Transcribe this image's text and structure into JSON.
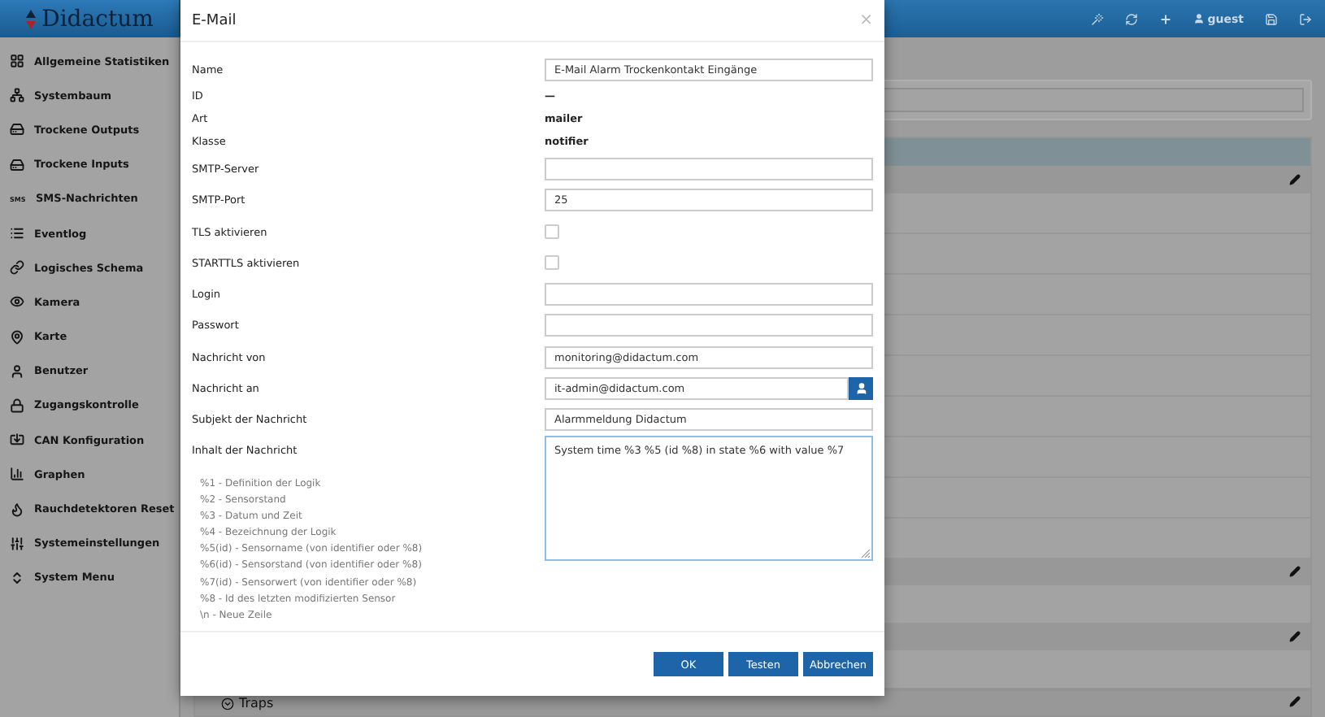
{
  "topbar": {
    "logo": "Didactum",
    "user": "guest"
  },
  "sidebar": {
    "items": [
      {
        "label": "Allgemeine Statistiken"
      },
      {
        "label": "Systembaum"
      },
      {
        "label": "Trockene Outputs"
      },
      {
        "label": "Trockene Inputs"
      },
      {
        "label": "SMS-Nachrichten",
        "badge": "SMS"
      },
      {
        "label": "Eventlog"
      },
      {
        "label": "Logisches Schema"
      },
      {
        "label": "Kamera"
      },
      {
        "label": "Karte"
      },
      {
        "label": "Benutzer"
      },
      {
        "label": "Zugangskontrolle"
      },
      {
        "label": "CAN Konfiguration"
      },
      {
        "label": "Graphen"
      },
      {
        "label": "Rauchdetektoren Reset"
      },
      {
        "label": "Systemeinstellungen"
      },
      {
        "label": "System Menu"
      }
    ]
  },
  "background": {
    "section_label": "Traps"
  },
  "dialog": {
    "title": "E-Mail",
    "close": "×",
    "fields": [
      {
        "kind": "text",
        "label": "Name",
        "value": "E-Mail Alarm Trockenkontakt Eingänge"
      },
      {
        "kind": "static",
        "label": "ID",
        "value": "—"
      },
      {
        "kind": "static",
        "label": "Art",
        "value": "mailer"
      },
      {
        "kind": "static",
        "label": "Klasse",
        "value": "notifier"
      },
      {
        "kind": "text",
        "label": "SMTP-Server"
      },
      {
        "kind": "text",
        "label": "SMTP-Port",
        "value": "25"
      },
      {
        "kind": "checkbox",
        "label": "TLS aktivieren",
        "checked": false
      },
      {
        "kind": "checkbox",
        "label": "STARTTLS aktivieren",
        "checked": false
      },
      {
        "kind": "text",
        "label": "Login"
      },
      {
        "kind": "text",
        "label": "Passwort"
      },
      {
        "kind": "text",
        "label": "Nachricht von",
        "value": "monitoring@didactum.com"
      },
      {
        "kind": "picker",
        "label": "Nachricht an",
        "value": "it-admin@didactum.com"
      },
      {
        "kind": "text",
        "label": "Subjekt der Nachricht",
        "value": "Alarmmeldung Didactum"
      },
      {
        "kind": "textarea",
        "label": "Inhalt der Nachricht",
        "value": "System time %3 %5 (id %8) in state %6 with value %7"
      }
    ],
    "hints": [
      "%1 - Definition der Logik",
      "%2 - Sensorstand",
      "%3 - Datum und Zeit",
      "%4 - Bezeichnung der Logik",
      "%5(id) - Sensorname (von identifier oder %8)",
      "%6(id) - Sensorstand (von identifier oder %8)",
      "%7(id) - Sensorwert (von identifier oder %8)",
      "%8 - Id des letzten modifizierten Sensor",
      "\\n - Neue Zeile"
    ],
    "buttons": [
      "OK",
      "Testen",
      "Abbrechen"
    ]
  }
}
